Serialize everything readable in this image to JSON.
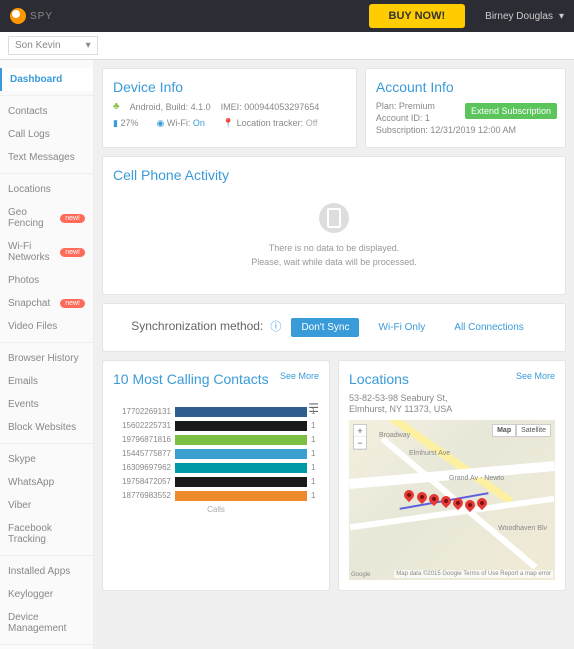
{
  "header": {
    "brand": "SPY",
    "buy": "BUY NOW!",
    "user": "Birney Douglas"
  },
  "device_picker": "Son Kevin",
  "sidebar": {
    "groups": [
      [
        {
          "label": "Dashboard",
          "active": true
        }
      ],
      [
        {
          "label": "Contacts"
        },
        {
          "label": "Call Logs"
        },
        {
          "label": "Text Messages"
        }
      ],
      [
        {
          "label": "Locations"
        },
        {
          "label": "Geo Fencing",
          "badge": "new!"
        },
        {
          "label": "Wi-Fi Networks",
          "badge": "new!"
        },
        {
          "label": "Photos"
        },
        {
          "label": "Snapchat",
          "badge": "new!"
        },
        {
          "label": "Video Files"
        }
      ],
      [
        {
          "label": "Browser History"
        },
        {
          "label": "Emails"
        },
        {
          "label": "Events"
        },
        {
          "label": "Block Websites"
        }
      ],
      [
        {
          "label": "Skype"
        },
        {
          "label": "WhatsApp"
        },
        {
          "label": "Viber"
        },
        {
          "label": "Facebook Tracking"
        }
      ],
      [
        {
          "label": "Installed Apps"
        },
        {
          "label": "Keylogger"
        },
        {
          "label": "Device Management"
        }
      ]
    ]
  },
  "device_info": {
    "title": "Device Info",
    "os": "Android,",
    "build_label": "Build:",
    "build": "4.1.0",
    "imei_label": "IMEI:",
    "imei": "000944053297654",
    "battery": "27%",
    "wifi_label": "Wi-Fi:",
    "wifi": "On",
    "tracker_label": "Location tracker:",
    "tracker": "Off"
  },
  "account_info": {
    "title": "Account Info",
    "plan_label": "Plan:",
    "plan": "Premium",
    "acct_label": "Account ID:",
    "acct": "1",
    "sub_label": "Subscription:",
    "sub": "12/31/2019 12:00 AM",
    "extend": "Extend Subscription"
  },
  "activity": {
    "title": "Cell Phone Activity",
    "line1": "There is no data to be displayed.",
    "line2": "Please, wait while data will be processed."
  },
  "sync": {
    "label": "Synchronization method:",
    "b1": "Don't Sync",
    "b2": "Wi-Fi Only",
    "b3": "All Connections"
  },
  "contacts": {
    "title": "10 Most Calling Contacts",
    "see_more": "See More",
    "caption": "Calls"
  },
  "locations": {
    "title": "Locations",
    "see_more": "See More",
    "addr1": "53-82-53-98 Seabury St,",
    "addr2": "Elmhurst, NY 11373, USA",
    "map_btn": "Map",
    "sat_btn": "Satellite",
    "attr": "Map data ©2015 Google   Terms of Use   Report a map error",
    "goog": "Google",
    "street1": "Broadway",
    "street2": "Grand Av - Newto",
    "street3": "Woodhaven Blv",
    "street4": "Elmhurst Ave"
  },
  "chart_data": {
    "type": "bar",
    "orientation": "horizontal",
    "title": "10 Most Calling Contacts",
    "xlabel": "Calls",
    "series": [
      {
        "name": "17702269131",
        "value": 1,
        "color": "#2f5f8f"
      },
      {
        "name": "15602225731",
        "value": 1,
        "color": "#1a1a1a"
      },
      {
        "name": "19796871816",
        "value": 1,
        "color": "#7bc043"
      },
      {
        "name": "15445775877",
        "value": 1,
        "color": "#3aa0d0"
      },
      {
        "name": "16309697962",
        "value": 1,
        "color": "#0099a8"
      },
      {
        "name": "19758472057",
        "value": 1,
        "color": "#1a1a1a"
      },
      {
        "name": "18776983552",
        "value": 1,
        "color": "#ee8a2e"
      }
    ]
  }
}
